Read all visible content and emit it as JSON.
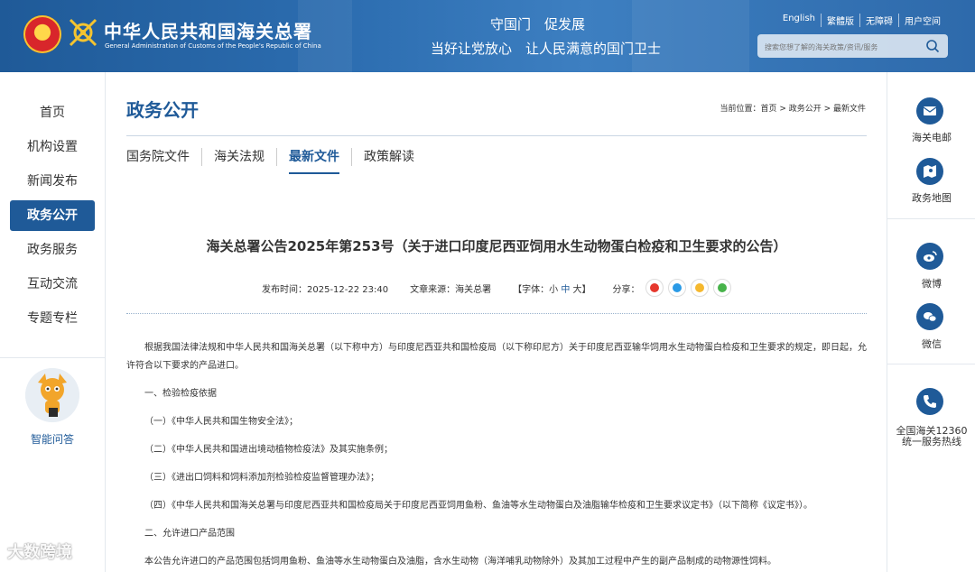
{
  "header": {
    "brand_cn": "中华人民共和国海关总署",
    "brand_en": "General Administration of Customs of the People's Republic of China",
    "slogan1": "守国门　促发展",
    "slogan2": "当好让党放心　让人民满意的国门卫士",
    "links": [
      "English",
      "繁體版",
      "无障碍",
      "用户空间"
    ],
    "search_placeholder": "搜索您想了解的海关政策/资讯/服务"
  },
  "leftnav": {
    "items": [
      "首页",
      "机构设置",
      "新闻发布",
      "政务公开",
      "政务服务",
      "互动交流",
      "专题专栏"
    ],
    "active": "政务公开",
    "ai_label": "智能问答"
  },
  "rightrail": {
    "items": [
      "海关电邮",
      "政务地图",
      "微博",
      "微信",
      "全国海关12360",
      "统一服务热线"
    ]
  },
  "main": {
    "section_title": "政务公开",
    "breadcrumb": "当前位置：首页 > 政务公开 > 最新文件",
    "tabs": [
      "国务院文件",
      "海关法规",
      "最新文件",
      "政策解读"
    ],
    "active_tab": "最新文件"
  },
  "article": {
    "title": "海关总署公告2025年第253号（关于进口印度尼西亚饲用水生动物蛋白检疫和卫生要求的公告）",
    "publish_label": "发布时间：2025-12-22 23:40",
    "source_label": "文章来源：海关总署",
    "font_label": "【字体：",
    "font_small": "小",
    "font_mid": "中",
    "font_large": "大",
    "font_end": "】",
    "share_label": "分享：",
    "share_icons": [
      "weibo-icon",
      "qq-icon",
      "qzone-icon",
      "wechat-icon"
    ],
    "paragraphs": [
      "根据我国法律法规和中华人民共和国海关总署（以下称中方）与印度尼西亚共和国检疫局（以下称印尼方）关于印度尼西亚输华饲用水生动物蛋白检疫和卫生要求的规定，即日起，允许符合以下要求的产品进口。",
      "一、检验检疫依据",
      "（一）《中华人民共和国生物安全法》；",
      "（二）《中华人民共和国进出境动植物检疫法》及其实施条例；",
      "（三）《进出口饲料和饲料添加剂检验检疫监督管理办法》；",
      "（四）《中华人民共和国海关总署与印度尼西亚共和国检疫局关于印度尼西亚饲用鱼粉、鱼油等水生动物蛋白及油脂输华检疫和卫生要求议定书》（以下简称《议定书》）。",
      "二、允许进口产品范围",
      "本公告允许进口的产品范围包括饲用鱼粉、鱼油等水生动物蛋白及油脂，含水生动物（海洋哺乳动物除外）及其加工过程中产生的副产品制成的动物源性饲料。"
    ]
  },
  "watermark": "大数跨境",
  "colors": {
    "brand_blue": "#1f5a98",
    "header_blue": "#2c6db0"
  }
}
